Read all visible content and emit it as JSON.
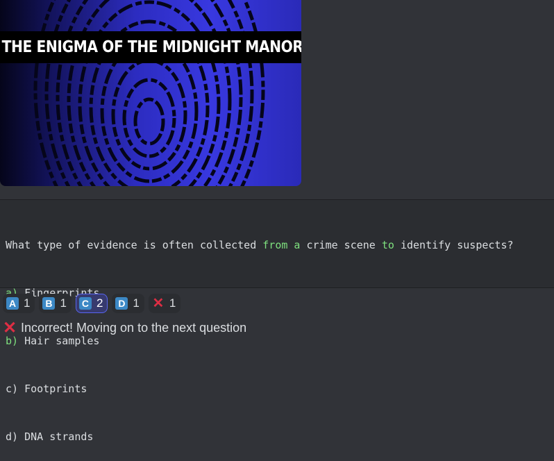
{
  "embed": {
    "image_title": "THE ENIGMA OF THE MIDNIGHT MANOR"
  },
  "question": {
    "text_parts": [
      "What type of evidence is often collected ",
      "from",
      " ",
      "a",
      " crime scene ",
      "to",
      " identify suspects?"
    ],
    "options": [
      {
        "letter": "a)",
        "text": " Fingerprints"
      },
      {
        "letter": "b)",
        "text": " Hair samples"
      },
      {
        "letter": "c)",
        "text": " Footprints"
      },
      {
        "letter": "d)",
        "text": " DNA strands"
      }
    ],
    "highlight_color": "#7ee07e"
  },
  "reactions": [
    {
      "emoji": "A",
      "count": "1",
      "active": false
    },
    {
      "emoji": "B",
      "count": "1",
      "active": false
    },
    {
      "emoji": "C",
      "count": "2",
      "active": true
    },
    {
      "emoji": "D",
      "count": "1",
      "active": false
    },
    {
      "emoji": "cross-mark",
      "count": "1",
      "active": false
    }
  ],
  "status": {
    "icon": "cross-mark",
    "text": "Incorrect! Moving on to the next question"
  },
  "colors": {
    "background": "#313338",
    "codeblock": "#2b2d31",
    "reaction_active_border": "#5865f2",
    "emoji_blue": "#3c88c5",
    "cross_red": "#dd2e44"
  }
}
